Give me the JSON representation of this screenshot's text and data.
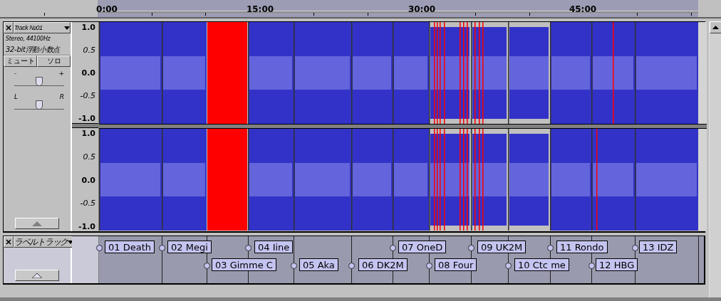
{
  "ruler": {
    "ticks": [
      "0:00",
      "15:00",
      "30:00",
      "45:00"
    ]
  },
  "audio_track": {
    "name": "Track №01",
    "info": [
      "Stereo, 44100Hz",
      "32-bit浮動小数点"
    ],
    "buttons": [
      "ミュート",
      "ソロ"
    ],
    "gain": {
      "min": "-",
      "max": "+",
      "level": 0.5
    },
    "pan": {
      "min": "L",
      "max": "R",
      "level": 0.5
    },
    "channels": [
      {
        "scale": [
          "1.0",
          "0.5",
          "0.0",
          "-0.5",
          "-1.0"
        ]
      },
      {
        "scale": [
          "1.0",
          "0.5",
          "0.0",
          "-0.5",
          "-1.0"
        ]
      }
    ]
  },
  "label_track": {
    "name": "ラベルトラック",
    "labels": [
      {
        "text": "01 Death"
      },
      {
        "text": "02 Megi"
      },
      {
        "text": "03 Gimme C"
      },
      {
        "text": "04 Iine"
      },
      {
        "text": "05 Aka"
      },
      {
        "text": "06 DK2M"
      },
      {
        "text": "07 OneD"
      },
      {
        "text": "08 Four"
      },
      {
        "text": "09 UK2M"
      },
      {
        "text": "10 Ctc me"
      },
      {
        "text": "11 Rondo"
      },
      {
        "text": "12 HBG"
      },
      {
        "text": "13 IDZ"
      }
    ]
  }
}
